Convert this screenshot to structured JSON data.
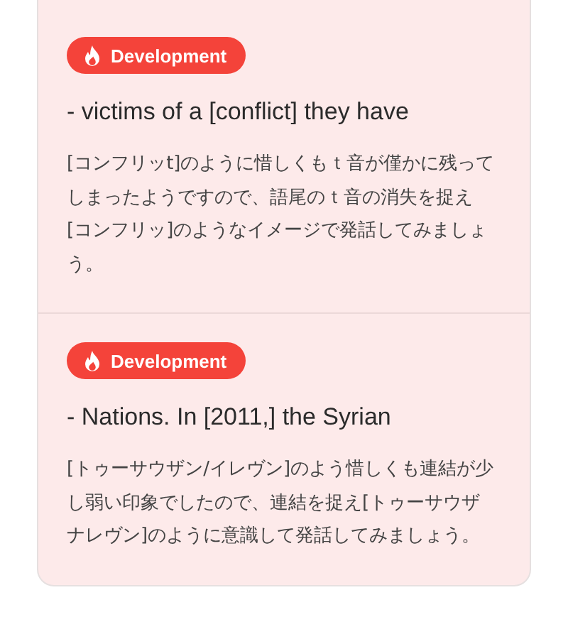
{
  "entries": [
    {
      "tag": "Development",
      "phrase": "- victims of a [conflict] they have",
      "comment": "[コンフリッt]のように惜しくもｔ音が僅かに残ってしまったようですので、語尾のｔ音の消失を捉え[コンフリッ]のようなイメージで発話してみましょう。"
    },
    {
      "tag": "Development",
      "phrase": "- Nations. In [2011,] the Syrian",
      "comment": "[トゥーサウザン/イレヴン]のよう惜しくも連結が少し弱い印象でしたので、連結を捉え[トゥーサウザナレヴン]のように意識して発話してみましょう。"
    }
  ]
}
